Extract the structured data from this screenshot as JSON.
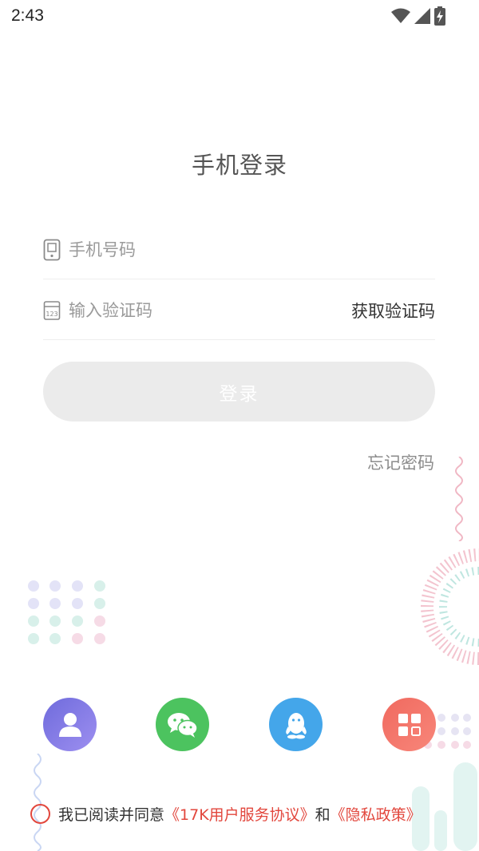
{
  "status_bar": {
    "time": "2:43"
  },
  "page": {
    "title": "手机登录"
  },
  "form": {
    "phone_placeholder": "手机号码",
    "code_placeholder": "输入验证码",
    "get_code_label": "获取验证码",
    "login_label": "登录",
    "forgot_label": "忘记密码"
  },
  "agreement": {
    "prefix": "我已阅读并同意",
    "terms_link": "《17K用户服务协议》",
    "conjunction": "和",
    "privacy_link": "《隐私政策》"
  },
  "colors": {
    "accent_red": "#e2473d",
    "wechat_green": "#4cc35f",
    "qq_blue": "#44a6ea",
    "account_purple": "#7a74e0"
  },
  "icons": [
    "phone-icon",
    "keypad-icon",
    "account-icon",
    "wechat-icon",
    "qq-icon",
    "more-apps-icon"
  ]
}
